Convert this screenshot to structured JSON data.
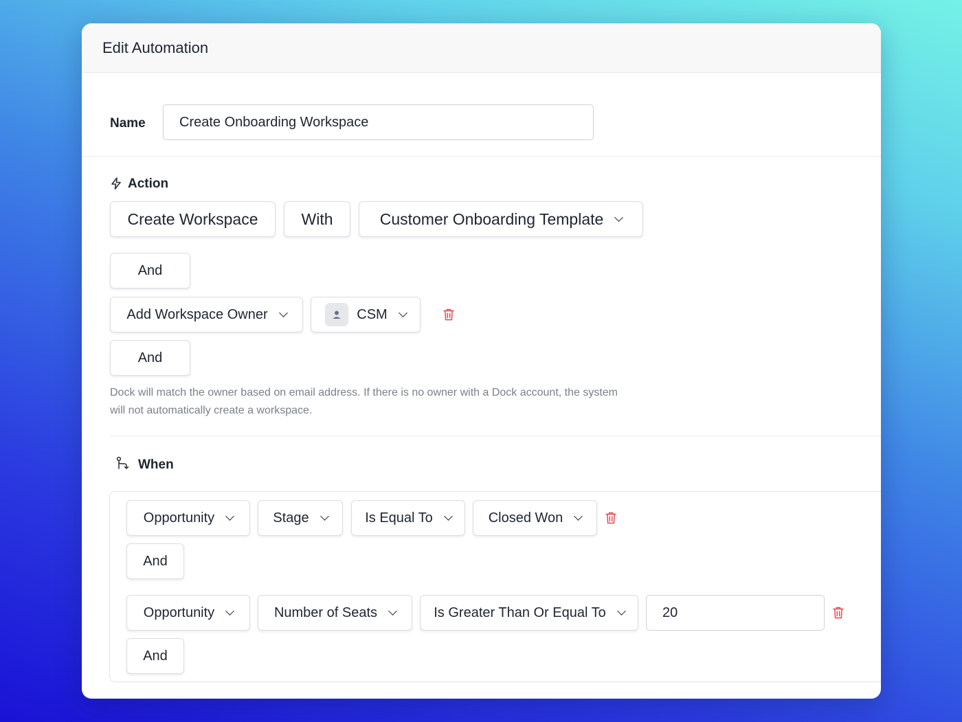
{
  "window": {
    "title": "Edit Automation"
  },
  "name_field": {
    "label": "Name",
    "value": "Create Onboarding Workspace"
  },
  "action": {
    "heading": "Action",
    "create_label": "Create Workspace",
    "with_label": "With",
    "template_label": "Customer Onboarding Template",
    "and_1": "And",
    "owner_label": "Add Workspace Owner",
    "owner_value": "CSM",
    "and_2": "And",
    "note": "Dock will match the owner based on email address. If there is no owner with a Dock account, the system will not automatically create a workspace."
  },
  "when": {
    "heading": "When",
    "conditions": [
      {
        "object": "Opportunity",
        "field": "Stage",
        "operator": "Is Equal To",
        "value": "Closed Won",
        "and_label": "And"
      },
      {
        "object": "Opportunity",
        "field": "Number of Seats",
        "operator": "Is Greater Than Or Equal To",
        "value": "20",
        "and_label": "And"
      }
    ]
  },
  "colors": {
    "delete_icon": "#e5484d",
    "page_gradient_start": "#1a12d6",
    "page_gradient_end": "#74f2e6"
  },
  "icons": [
    "lightning-icon",
    "branch-icon",
    "trash-icon",
    "user-icon",
    "chevron-down-icon"
  ]
}
